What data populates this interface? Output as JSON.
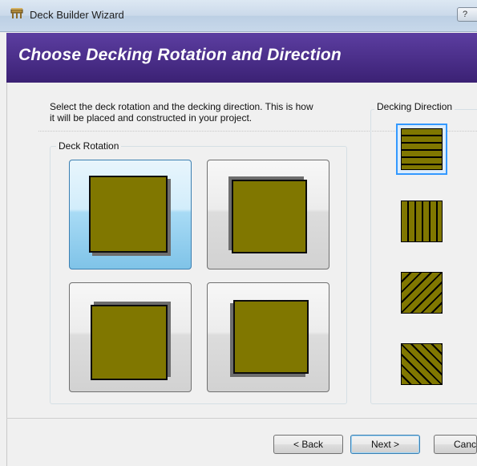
{
  "window": {
    "title": "Deck Builder Wizard",
    "help_glyph": "?",
    "icon": "deck-app-icon"
  },
  "banner": {
    "title": "Choose Decking Rotation and Direction"
  },
  "instructions": {
    "line1": "Select the deck rotation and the decking direction. This is how",
    "line2": "it will be placed and constructed in your project."
  },
  "deck_rotation": {
    "label": "Deck Rotation",
    "selected_index": 0,
    "options": [
      {
        "id": "rotation-1",
        "shadow": "bottom-right",
        "icon": "deck-square-icon"
      },
      {
        "id": "rotation-2",
        "shadow": "top-left",
        "icon": "deck-square-icon"
      },
      {
        "id": "rotation-3",
        "shadow": "top-right",
        "icon": "deck-square-icon"
      },
      {
        "id": "rotation-4",
        "shadow": "bottom-left",
        "icon": "deck-square-icon"
      }
    ]
  },
  "decking_direction": {
    "label": "Decking Direction",
    "selected_index": 0,
    "options": [
      {
        "id": "horizontal",
        "icon": "horizontal-boards-icon"
      },
      {
        "id": "vertical",
        "icon": "vertical-boards-icon"
      },
      {
        "id": "diagonal-a",
        "icon": "diagonal-boards-icon"
      },
      {
        "id": "diagonal-b",
        "icon": "diagonal-boards-reverse-icon"
      }
    ]
  },
  "buttons": {
    "back": "< Back",
    "next": "Next >",
    "cancel": "Cancel"
  },
  "colors": {
    "banner": "#4a2e8a",
    "deck_fill": "#807700",
    "selection": "#3399ff"
  }
}
